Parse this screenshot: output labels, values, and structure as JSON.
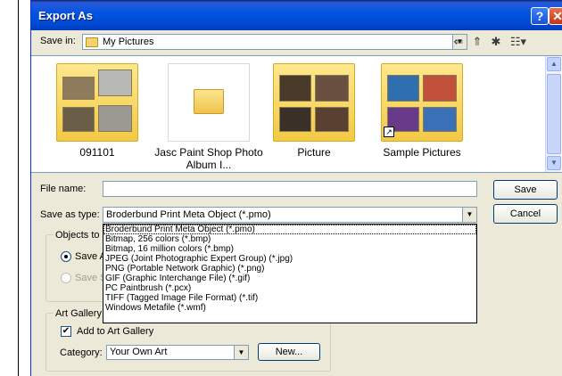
{
  "window": {
    "title": "Export As",
    "help": "?",
    "close": "✕"
  },
  "save_in": {
    "label": "Save in:",
    "value": "My Pictures",
    "toolbar_icons": [
      "back-icon",
      "up-folder-icon",
      "new-folder-icon",
      "view-menu-icon"
    ]
  },
  "files": [
    {
      "name": "091101",
      "icon": "folder-thumbnail-icon"
    },
    {
      "name": "Jasc Paint Shop Photo Album I...",
      "icon": "folder-icon"
    },
    {
      "name": "Picture",
      "icon": "folder-thumbnail-icon"
    },
    {
      "name": "Sample Pictures",
      "icon": "folder-shortcut-thumbnail-icon"
    }
  ],
  "file_name": {
    "label": "File name:",
    "value": ""
  },
  "save_as_type": {
    "label": "Save as type:",
    "value": "Broderbund Print Meta Object (*.pmo)",
    "options": [
      "Broderbund Print Meta Object (*.pmo)",
      "Bitmap, 256 colors (*.bmp)",
      "Bitmap, 16 million colors (*.bmp)",
      "JPEG (Joint Photographic Expert Group) (*.jpg)",
      "PNG (Portable Network Graphic) (*.png)",
      "GIF (Graphic Interchange File) (*.gif)",
      "PC Paintbrush (*.pcx)",
      "TIFF (Tagged Image File Format) (*.tif)",
      "Windows Metafile (*.wmf)"
    ]
  },
  "buttons": {
    "save": "Save",
    "cancel": "Cancel",
    "new": "New..."
  },
  "objects_group": {
    "title": "Objects to S",
    "option1": "Save A",
    "option2": "Save S"
  },
  "art_gallery": {
    "title": "Art Gallery",
    "checkbox_label": "Add to Art Gallery",
    "checked": true,
    "category_label": "Category:",
    "category_value": "Your Own Art"
  }
}
